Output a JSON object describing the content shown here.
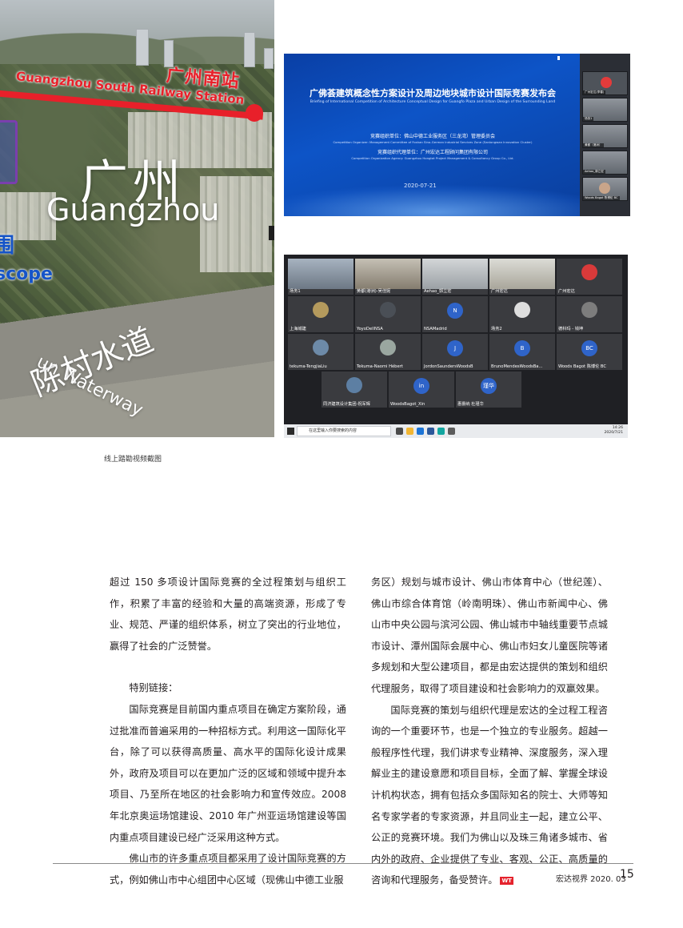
{
  "aerial_map": {
    "station_cn": "广州南站",
    "station_en": "Guangzhou South Railway Station",
    "city_cn": "广州",
    "city_en": "Guangzhou",
    "scope_cn": "围",
    "scope_en": "scope",
    "waterway_cn": "陈村水道",
    "waterway_en": "un Waterway",
    "rail_color": "#e8202a"
  },
  "briefing_slide": {
    "title": "广佛荟建筑概念性方案设计及周边地块城市设计国际竞赛发布会",
    "subtitle": "Briefing of International Competition of Architecture Conceptual Design for Guangfo Plaza and Urban Design of the Surrounding Land",
    "organizer_cn": "竞赛组织单位：佛山中德工业服务区（三龙湾）管理委员会",
    "organizer_en": "Competition Organizer: Management Committee of Foshan Sino-German Industrial Services Zone (Sanlongwan Innovation Cluster)",
    "agency_cn": "竞赛组织代理单位：广州宏达工程顾问集团有限公司",
    "agency_en": "Competition Organization Agency: Guangzhou Hongtat Project Management & Consultancy Group Co., Ltd.",
    "date": "2020-07-21",
    "sidebar_participants": [
      "广州宏达(李春)",
      "场务1",
      "黄都（港洲）",
      "Aehao_郭立宏",
      "",
      "Woods Bagot 陈博伦 BC"
    ]
  },
  "video_meeting": {
    "participants": [
      {
        "name": "场务1",
        "type": "camera"
      },
      {
        "name": "黄都(港洲)-吴佳妮",
        "type": "camera"
      },
      {
        "name": "Aehao_郭立宏",
        "type": "camera"
      },
      {
        "name": "广州宏达",
        "type": "camera"
      },
      {
        "name": "广州宏达",
        "type": "photo"
      },
      {
        "name": "上海城建",
        "type": "photo"
      },
      {
        "name": "YoyoDellNSA",
        "type": "photo"
      },
      {
        "name": "NSAMadrid",
        "type": "avatar",
        "initial": "N"
      },
      {
        "name": "场务2",
        "type": "photo"
      },
      {
        "name": "德科玛 - 钱坤",
        "type": "photo"
      },
      {
        "name": "tekuma-TengjiaLiu",
        "type": "photo"
      },
      {
        "name": "Tekuma-Naomi Hébert",
        "type": "photo"
      },
      {
        "name": "JordonSaundersWoodsB",
        "type": "avatar",
        "initial": "J"
      },
      {
        "name": "BrunoMendesWoodsBa...",
        "type": "avatar",
        "initial": "B"
      },
      {
        "name": "Woods Bagot 陈博伦 BC",
        "type": "avatar",
        "initial": "BC"
      },
      {
        "name": "同济建筑设计集团-祝军辉",
        "type": "photo"
      },
      {
        "name": "WoodsBagot_Xin",
        "type": "avatar",
        "initial": "in"
      },
      {
        "name": "惠爵纳 杜瑾华",
        "type": "avatar",
        "initial": "瑾华"
      }
    ],
    "taskbar_search": "在这里输入你要搜索的内容",
    "clock_time": "14:26",
    "clock_date": "2020/7/21"
  },
  "caption": "线上踏勘视频截图",
  "col1": {
    "p1": "超过 150 多项设计国际竞赛的全过程策划与组织工作，积累了丰富的经验和大量的高端资源，形成了专业、规范、严谨的组织体系，树立了突出的行业地位，赢得了社会的广泛赞誉。",
    "p2": "特别链接：",
    "p3": "国际竞赛是目前国内重点项目在确定方案阶段，通过批准而普遍采用的一种招标方式。利用这一国际化平台，除了可以获得高质量、高水平的国际化设计成果外，政府及项目可以在更加广泛的区域和领域中提升本项目、乃至所在地区的社会影响力和宣传效应。2008 年北京奥运场馆建设、2010 年广州亚运场馆建设等国内重点项目建设已经广泛采用这种方式。",
    "p4": "佛山市的许多重点项目都采用了设计国际竞赛的方式，例如佛山市中心组团中心区域（现佛山中德工业服"
  },
  "col2": {
    "p1": "务区）规划与城市设计、佛山市体育中心（世纪莲）、佛山市综合体育馆（岭南明珠）、佛山市新闻中心、佛山市中央公园与滨河公园、佛山城市中轴线重要节点城市设计、潭州国际会展中心、佛山市妇女儿童医院等诸多规划和大型公建项目，都是由宏达提供的策划和组织代理服务，取得了项目建设和社会影响力的双赢效果。",
    "p2": "国际竞赛的策划与组织代理是宏达的全过程工程咨询的一个重要环节，也是一个独立的专业服务。超越一般程序性代理，我们讲求专业精神、深度服务，深入理解业主的建设意愿和项目目标，全面了解、掌握全球设计机构状态，拥有包括众多国际知名的院士、大师等知名专家学者的专家资源，并且同业主一起，建立公平、公正的竞赛环境。我们为佛山以及珠三角诸多城市、省内外的政府、企业提供了专业、客观、公正、高质量的咨询和代理服务，备受赞许。",
    "end_mark": "WT"
  },
  "footer": {
    "magazine": "宏达视界  2020. 03",
    "page": "15"
  }
}
